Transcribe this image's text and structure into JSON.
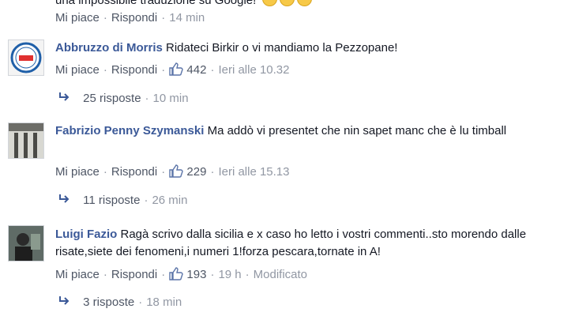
{
  "top": {
    "text_fragment": "una impossibile traduzione su Google!",
    "like_label": "Mi piace",
    "reply_label": "Rispondi",
    "time": "14 min"
  },
  "comments": [
    {
      "author": "Abbruzzo di Morris",
      "text": "Ridateci Birkir o vi mandiamo la Pezzopane!",
      "like_label": "Mi piace",
      "reply_label": "Rispondi",
      "likes": "442",
      "time": "Ieri alle 10.32",
      "replies": "25 risposte",
      "replies_time": "10 min"
    },
    {
      "author": "Fabrizio Penny Szymanski",
      "text": "Ma addò vi presentet che nin sapet manc che è lu timball",
      "like_label": "Mi piace",
      "reply_label": "Rispondi",
      "likes": "229",
      "time": "Ieri alle 15.13",
      "replies": "11 risposte",
      "replies_time": "26 min"
    },
    {
      "author": "Luigi Fazio",
      "text": "Ragà scrivo dalla sicilia e x caso ho letto i vostri commenti..sto morendo dalle risate,siete dei fenomeni,i numeri 1!forza pescara,tornate in A!",
      "like_label": "Mi piace",
      "reply_label": "Rispondi",
      "likes": "193",
      "time": "19 h",
      "edited": "Modificato",
      "replies": "3 risposte",
      "replies_time": "18 min"
    }
  ],
  "colors": {
    "name": "#3b5998",
    "link": "#4e5665",
    "muted": "#9197a3"
  }
}
